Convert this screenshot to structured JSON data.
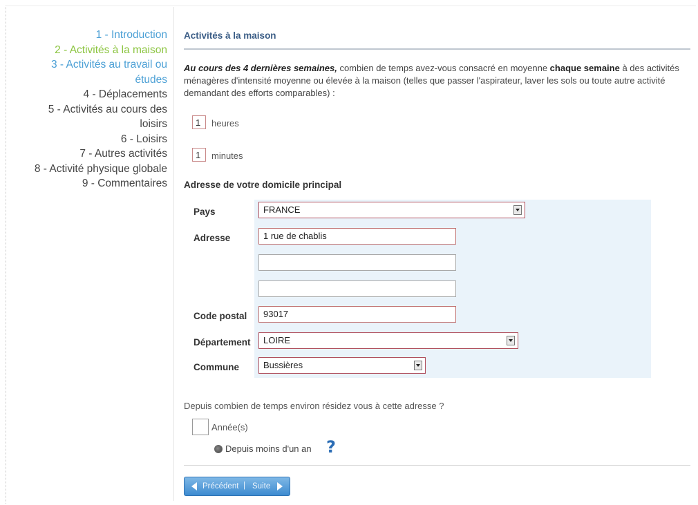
{
  "sidebar": {
    "items": [
      {
        "label": "1 - Introduction",
        "state": "done"
      },
      {
        "label": "2 - Activités à la maison",
        "state": "active"
      },
      {
        "label": "3 - Activités au travail ou",
        "state": "done"
      },
      {
        "label": "études",
        "state": "done"
      },
      {
        "label": "4 - Déplacements",
        "state": "todo"
      },
      {
        "label": "5 - Activités au cours des",
        "state": "todo"
      },
      {
        "label": "loisirs",
        "state": "todo"
      },
      {
        "label": "6 - Loisirs",
        "state": "todo"
      },
      {
        "label": "7 - Autres activités",
        "state": "todo"
      },
      {
        "label": "8 - Activité physique globale",
        "state": "todo"
      },
      {
        "label": "9 - Commentaires",
        "state": "todo"
      }
    ]
  },
  "main": {
    "section_title": "Activités à la maison",
    "question": {
      "lead_bold": "Au cours des 4 dernières semaines,",
      "text1": " combien de temps avez-vous consacré en moyenne ",
      "bold2": "chaque semaine",
      "text2": " à des activités ménagères d'intensité moyenne ou élevée à la maison (telles que passer l'aspirateur, laver les sols ou toute autre activité demandant des efforts comparables) :"
    },
    "hours": {
      "value": "1",
      "unit": "heures"
    },
    "minutes": {
      "value": "1",
      "unit": "minutes"
    },
    "address_title": "Adresse de votre domicile principal",
    "address": {
      "country_label": "Pays",
      "country_value": "FRANCE",
      "address_label": "Adresse",
      "address_line1": "1 rue de chablis",
      "address_line2": "",
      "address_line3": "",
      "postal_label": "Code postal",
      "postal_value": "93017",
      "department_label": "Département",
      "department_value": "LOIRE",
      "commune_label": "Commune",
      "commune_value": "Bussières"
    },
    "duration_question": "Depuis combien de temps environ résidez vous à cette adresse ?",
    "years_label": "Année(s)",
    "years_value": "",
    "less_than_year_label": "Depuis moins d'un an",
    "help_glyph": "?"
  },
  "navigation": {
    "prev_label": "Précédent",
    "separator": "|",
    "next_label": "Suite"
  },
  "colors": {
    "link_done": "#4a9fd5",
    "link_active": "#8bc43f",
    "panel_bg": "#eaf3fa",
    "input_border": "#c07070",
    "nav_button": "#3d8bd0"
  }
}
